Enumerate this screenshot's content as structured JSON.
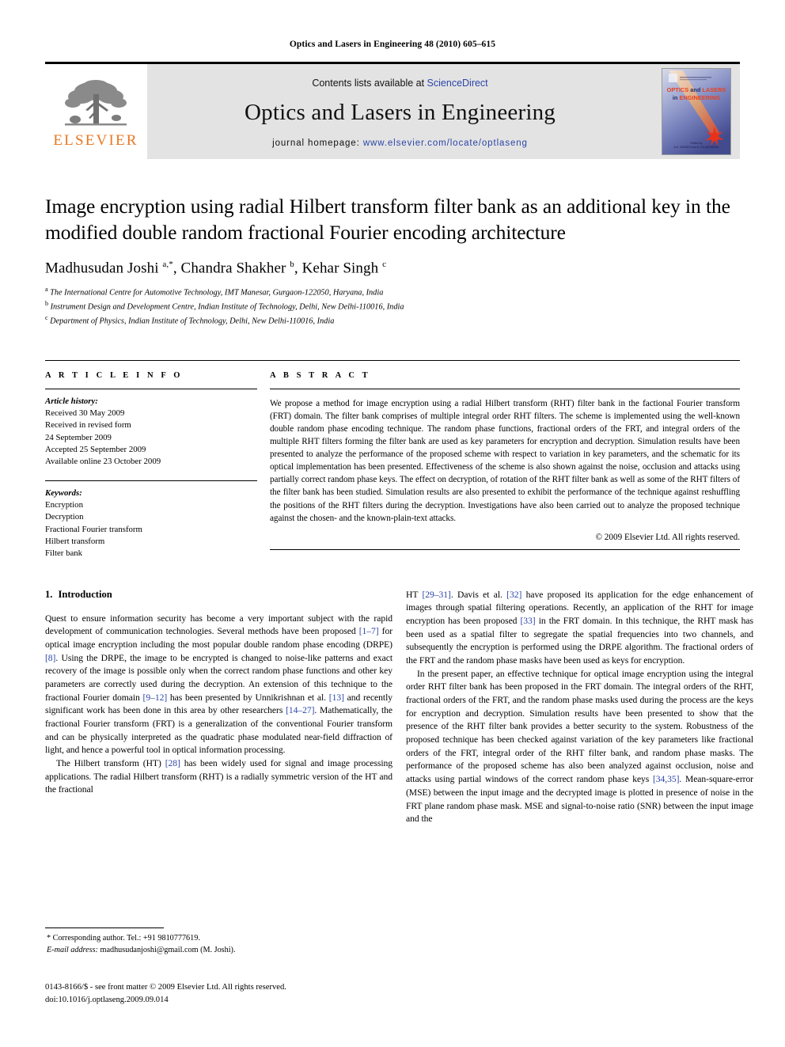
{
  "running_head": "Optics and Lasers in Engineering 48 (2010) 605–615",
  "masthead": {
    "contents_prefix": "Contents lists available at ",
    "contents_link": "ScienceDirect",
    "journal_name": "Optics and Lasers in Engineering",
    "homepage_prefix": "journal homepage: ",
    "homepage_url": "www.elsevier.com/locate/optlaseng",
    "publisher_wordmark": "ELSEVIER",
    "publisher_color": "#E87722",
    "link_color": "#2b45a8",
    "cover": {
      "line1": "OPTICS and LASERS",
      "line2": "in ENGINEERING",
      "editor_line1": "Edited by",
      "editor_line2": "A.K. ASUNDI and D. KUJAWINSKA"
    }
  },
  "article": {
    "title": "Image encryption using radial Hilbert transform filter bank as an additional key in the modified double random fractional Fourier encoding architecture",
    "authors_html": "Madhusudan Joshi <sup>a,*</sup>, Chandra Shakher <sup>b</sup>, Kehar Singh <sup>c</sup>",
    "affiliations": [
      {
        "marker": "a",
        "text": "The International Centre for Automotive Technology, IMT Manesar, Gurgaon-122050, Haryana, India"
      },
      {
        "marker": "b",
        "text": "Instrument Design and Development Centre, Indian Institute of Technology, Delhi, New Delhi-110016, India"
      },
      {
        "marker": "c",
        "text": "Department of Physics, Indian Institute of Technology, Delhi, New Delhi-110016, India"
      }
    ]
  },
  "article_info": {
    "heading": "A R T I C L E  I N F O",
    "history_label": "Article history:",
    "history_lines": [
      "Received 30 May 2009",
      "Received in revised form",
      "24 September 2009",
      "Accepted 25 September 2009",
      "Available online 23 October 2009"
    ],
    "keywords_label": "Keywords:",
    "keywords": [
      "Encryption",
      "Decryption",
      "Fractional Fourier transform",
      "Hilbert transform",
      "Filter bank"
    ]
  },
  "abstract": {
    "heading": "A B S T R A C T",
    "text": "We propose a method for image encryption using a radial Hilbert transform (RHT) filter bank in the factional Fourier transform (FRT) domain. The filter bank comprises of multiple integral order RHT filters. The scheme is implemented using the well-known double random phase encoding technique. The random phase functions, fractional orders of the FRT, and integral orders of the multiple RHT filters forming the filter bank are used as key parameters for encryption and decryption. Simulation results have been presented to analyze the performance of the proposed scheme with respect to variation in key parameters, and the schematic for its optical implementation has been presented. Effectiveness of the scheme is also shown against the noise, occlusion and attacks using partially correct random phase keys. The effect on decryption, of rotation of the RHT filter bank as well as some of the RHT filters of the filter bank has been studied. Simulation results are also presented to exhibit the performance of the technique against reshuffling the positions of the RHT filters during the decryption. Investigations have also been carried out to analyze the proposed technique against the chosen- and the known-plain-text attacks.",
    "copyright": "© 2009 Elsevier Ltd. All rights reserved."
  },
  "introduction": {
    "number": "1.",
    "title": "Introduction",
    "left_paragraphs": [
      "Quest to ensure information security has become a very important subject with the rapid development of communication technologies. Several methods have been proposed [1–7] for optical image encryption including the most popular double random phase encoding (DRPE) [8]. Using the DRPE, the image to be encrypted is changed to noise-like patterns and exact recovery of the image is possible only when the correct random phase functions and other key parameters are correctly used during the decryption. An extension of this technique to the fractional Fourier domain [9–12] has been presented by Unnikrishnan et al. [13] and recently significant work has been done in this area by other researchers [14–27]. Mathematically, the fractional Fourier transform (FRT) is a generalization of the conventional Fourier transform and can be physically interpreted as the quadratic phase modulated near-field diffraction of light, and hence a powerful tool in optical information processing.",
      "The Hilbert transform (HT) [28] has been widely used for signal and image processing applications. The radial Hilbert transform (RHT) is a radially symmetric version of the HT and the fractional"
    ],
    "right_paragraphs": [
      "HT [29–31]. Davis et al. [32] have proposed its application for the edge enhancement of images through spatial filtering operations. Recently, an application of the RHT for image encryption has been proposed [33] in the FRT domain. In this technique, the RHT mask has been used as a spatial filter to segregate the spatial frequencies into two channels, and subsequently the encryption is performed using the DRPE algorithm. The fractional orders of the FRT and the random phase masks have been used as keys for encryption.",
      "In the present paper, an effective technique for optical image encryption using the integral order RHT filter bank has been proposed in the FRT domain. The integral orders of the RHT, fractional orders of the FRT, and the random phase masks used during the process are the keys for encryption and decryption. Simulation results have been presented to show that the presence of the RHT filter bank provides a better security to the system. Robustness of the proposed technique has been checked against variation of the key parameters like fractional orders of the FRT, integral order of the RHT filter bank, and random phase masks. The performance of the proposed scheme has also been analyzed against occlusion, noise and attacks using partial windows of the correct random phase keys [34,35]. Mean-square-error (MSE) between the input image and the decrypted image is plotted in presence of noise in the FRT plane random phase mask. MSE and signal-to-noise ratio (SNR) between the input image and the"
    ]
  },
  "footnote": {
    "corresponding": "* Corresponding author. Tel.: +91 9810777619.",
    "email_label": "E-mail address:",
    "email": "madhusudanjoshi@gmail.com (M. Joshi)."
  },
  "footer": {
    "line1": "0143-8166/$ - see front matter © 2009 Elsevier Ltd. All rights reserved.",
    "line2": "doi:10.1016/j.optlaseng.2009.09.014"
  }
}
